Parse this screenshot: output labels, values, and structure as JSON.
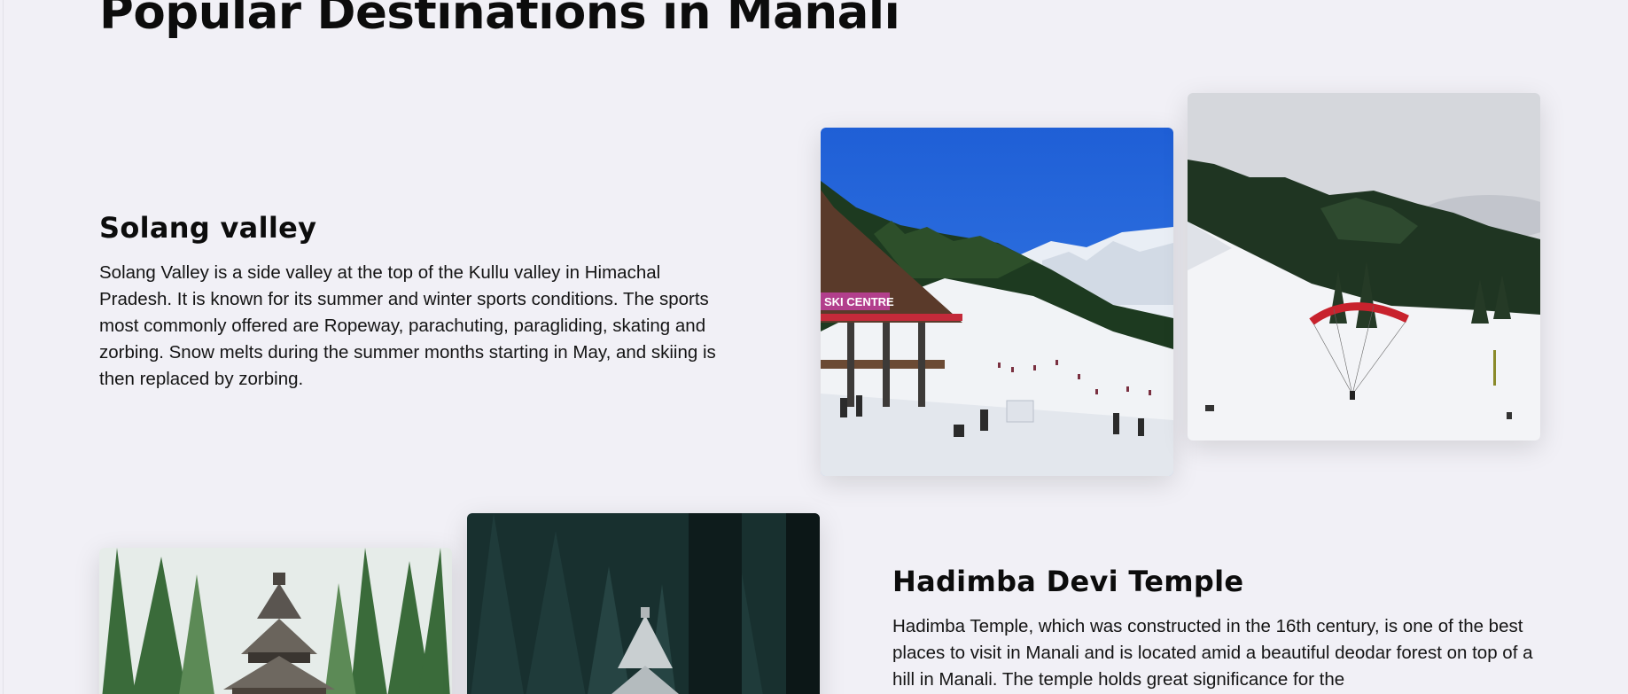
{
  "section": {
    "title": "Popular Destinations in Manali"
  },
  "destinations": [
    {
      "name": "Solang valley",
      "description": "Solang Valley is a side valley at the top of the Kullu valley in Himachal Pradesh. It is known for its summer and winter sports conditions. The sports most commonly offered are Ropeway, parachuting, paragliding, skating and zorbing. Snow melts during the summer months starting in May, and skiing is then replaced by zorbing.",
      "photos": [
        {
          "subject": "solang-ski-centre-photo",
          "sign_text": "SKI CENTRE"
        },
        {
          "subject": "solang-paragliding-photo"
        }
      ]
    },
    {
      "name": "Hadimba Devi Temple",
      "description": "Hadimba Temple, which was constructed in the 16th century, is one of the best places to visit in Manali and is located amid a beautiful deodar forest on top of a hill in Manali. The temple holds great significance for the",
      "photos": [
        {
          "subject": "hadimba-temple-daylight-photo"
        },
        {
          "subject": "hadimba-temple-forest-photo"
        }
      ]
    }
  ]
}
